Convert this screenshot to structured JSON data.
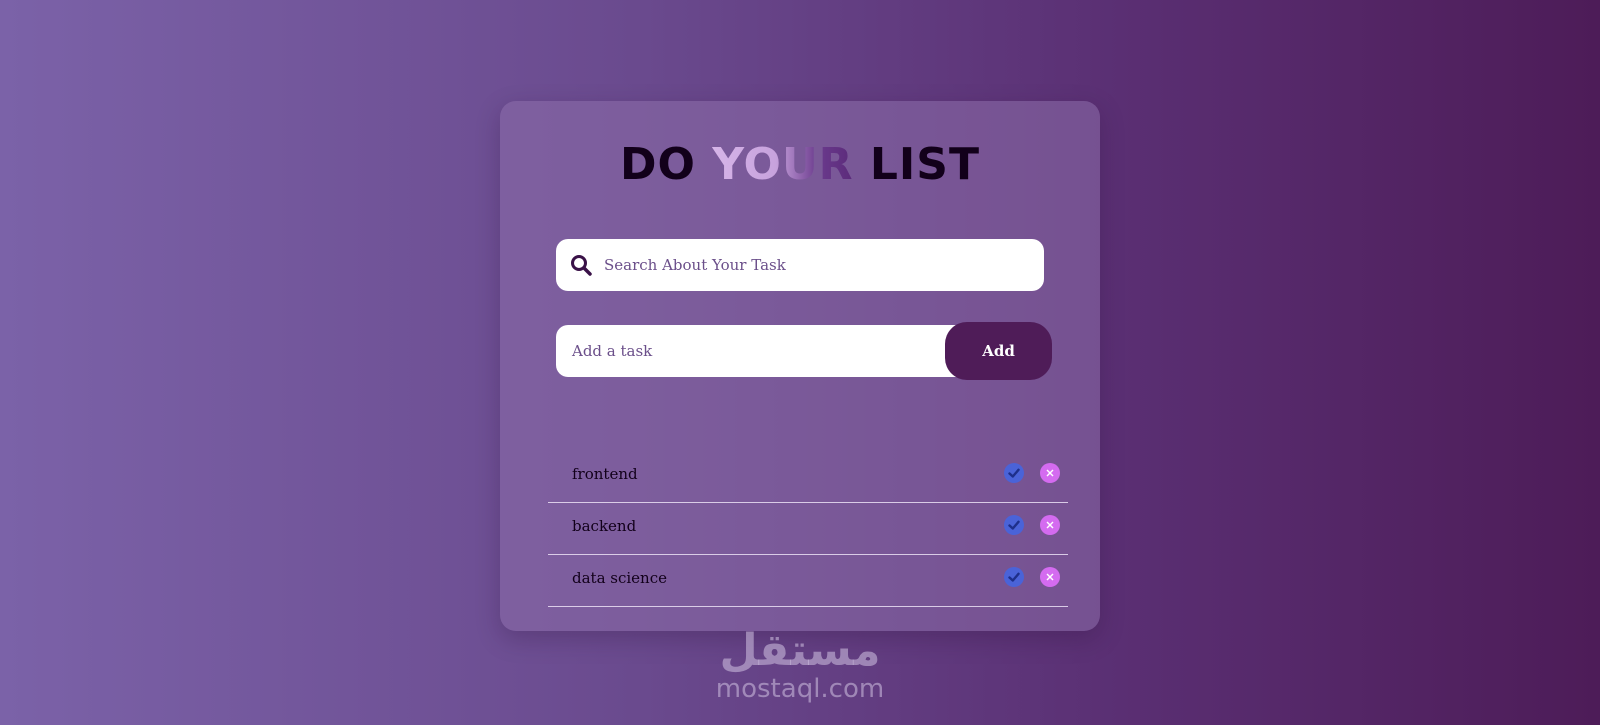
{
  "header": {
    "title_part1": "DO",
    "title_part2": "YOUR",
    "title_part3": "LIST"
  },
  "search": {
    "placeholder": "Search About Your Task",
    "icon": "search-icon"
  },
  "add_task": {
    "placeholder": "Add a task",
    "button_label": "Add"
  },
  "tasks": [
    {
      "label": "frontend",
      "done_icon": "check-circle-icon",
      "delete_icon": "close-circle-icon"
    },
    {
      "label": "backend",
      "done_icon": "check-circle-icon",
      "delete_icon": "close-circle-icon"
    },
    {
      "label": "data science",
      "done_icon": "check-circle-icon",
      "delete_icon": "close-circle-icon"
    }
  ],
  "watermark": {
    "arabic": "مستقل",
    "latin": "mostaql.com"
  },
  "colors": {
    "accent": "#4f1c58",
    "done": "#4a63d8",
    "delete": "#d46bf0"
  }
}
